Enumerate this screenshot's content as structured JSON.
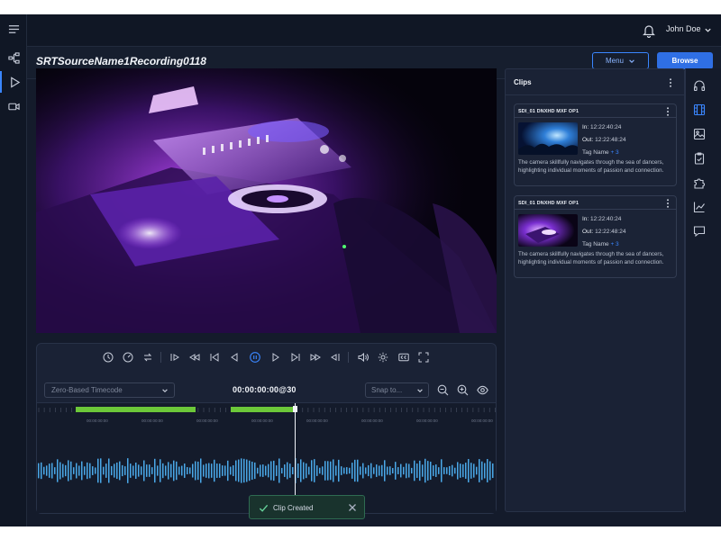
{
  "header": {
    "user_name": "John Doe"
  },
  "titlebar": {
    "title": "SRTSourceName1Recording0118",
    "menu_label": "Menu",
    "browse_label": "Browse"
  },
  "player": {
    "timecode_mode": "Zero-Based Timecode",
    "timecode": "00:00:00:00@30",
    "snap_placeholder": "Snap to..."
  },
  "timeline": {
    "tick_label": "00:00:00:00"
  },
  "toast": {
    "message": "Clip Created"
  },
  "clips": {
    "title": "Clips",
    "items": [
      {
        "title": "SDI_01 DNXHD MXF OP1",
        "in_label": "In:",
        "in_time": "12:22:40:24",
        "out_label": "Out:",
        "out_time": "12:22:48:24",
        "tag_label": "Tag Name",
        "tag_more": "+ 3",
        "description": "The camera skillfully navigates through the sea of dancers, highlighting individual moments of passion and connection."
      },
      {
        "title": "SDI_01 DNXHD MXF OP1",
        "in_label": "In:",
        "in_time": "12:22:40:24",
        "out_label": "Out:",
        "out_time": "12:22:48:24",
        "tag_label": "Tag Name",
        "tag_more": "+ 3",
        "description": "The camera skillfully navigates through the sea of dancers, highlighting individual moments of passion and connection."
      }
    ]
  },
  "colors": {
    "accent": "#3a86ff",
    "clip_marker": "#6cc839",
    "success": "#66d29a"
  }
}
